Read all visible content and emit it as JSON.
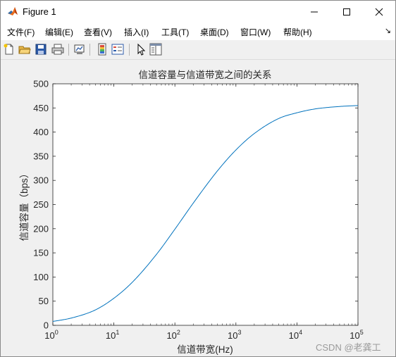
{
  "window": {
    "title": "Figure 1",
    "controls": {
      "minimize": "minimize",
      "maximize": "maximize",
      "close": "close"
    }
  },
  "menu": {
    "items": [
      {
        "label": "文件(F)"
      },
      {
        "label": "编辑(E)"
      },
      {
        "label": "查看(V)"
      },
      {
        "label": "插入(I)"
      },
      {
        "label": "工具(T)"
      },
      {
        "label": "桌面(D)"
      },
      {
        "label": "窗口(W)"
      },
      {
        "label": "帮助(H)"
      }
    ],
    "overflow_icon": "dock-arrow-icon"
  },
  "toolbar": {
    "buttons": [
      "new-figure-icon",
      "open-file-icon",
      "save-icon",
      "print-icon",
      "link-plot-icon",
      "insert-colorbar-icon",
      "insert-legend-icon",
      "edit-plot-cursor-icon",
      "property-inspector-icon"
    ]
  },
  "chart_data": {
    "type": "line",
    "title": "信道容量与信道带宽之间的关系",
    "xlabel": "信道带宽(Hz)",
    "ylabel": "信道容量（bps）",
    "xscale": "log",
    "xlim": [
      1,
      100000
    ],
    "ylim": [
      0,
      500
    ],
    "x_tick_labels": [
      {
        "base": "10",
        "exp": "0"
      },
      {
        "base": "10",
        "exp": "1"
      },
      {
        "base": "10",
        "exp": "2"
      },
      {
        "base": "10",
        "exp": "3"
      },
      {
        "base": "10",
        "exp": "4"
      },
      {
        "base": "10",
        "exp": "5"
      }
    ],
    "x_ticks": [
      1,
      10,
      100,
      1000,
      10000,
      100000
    ],
    "y_ticks": [
      "0",
      "50",
      "100",
      "150",
      "200",
      "250",
      "300",
      "350",
      "400",
      "450",
      "500"
    ],
    "y_tick_values": [
      0,
      50,
      100,
      150,
      200,
      250,
      300,
      350,
      400,
      450,
      500
    ],
    "grid": false,
    "series": [
      {
        "color": "#0072bd",
        "x": [
          1,
          2,
          5,
          10,
          20,
          50,
          100,
          200,
          500,
          1000,
          2000,
          5000,
          10000,
          20000,
          50000,
          100000
        ],
        "y": [
          8,
          15,
          32,
          56,
          89,
          147,
          199,
          253,
          320,
          363,
          397,
          428,
          440,
          448,
          453,
          455
        ]
      }
    ]
  },
  "watermark": "CSDN @老龚工"
}
